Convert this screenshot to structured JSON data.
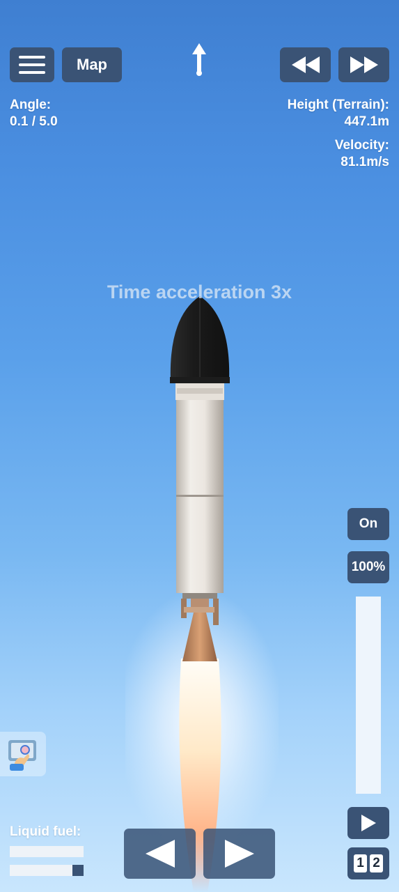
{
  "top_bar": {
    "menu_icon": "hamburger-icon",
    "map_label": "Map",
    "direction_icon": "up-arrow-icon",
    "slower_icon": "rewind-icon",
    "faster_icon": "fast-forward-icon"
  },
  "telemetry": {
    "angle_label": "Angle:",
    "angle_value": "0.1 / 5.0",
    "height_label": "Height (Terrain):",
    "height_value": "447.1m",
    "velocity_label": "Velocity:",
    "velocity_value": "81.1m/s"
  },
  "notification": "Time acceleration 3x",
  "throttle": {
    "toggle_label": "On",
    "percent_label": "100%",
    "level": 1.0
  },
  "bottom": {
    "fuel_label": "Liquid fuel:",
    "fuel_bars": [
      {
        "name": "fuel-tank-1",
        "fill": 0.0
      },
      {
        "name": "fuel-tank-2",
        "fill": 0.15
      }
    ],
    "rotate_left_icon": "left-triangle-icon",
    "rotate_right_icon": "right-triangle-icon",
    "stage_icon": "play-icon",
    "stage_digits": [
      "1",
      "2"
    ]
  },
  "side_widget_icon": "build-hand-icon",
  "colors": {
    "button_bg": "#3a5375",
    "sky_top": "#3f7fd1",
    "sky_bottom": "#c9e6fd",
    "nose_cone": "#1e1e1e",
    "engine_bell": "#c98c5e"
  }
}
